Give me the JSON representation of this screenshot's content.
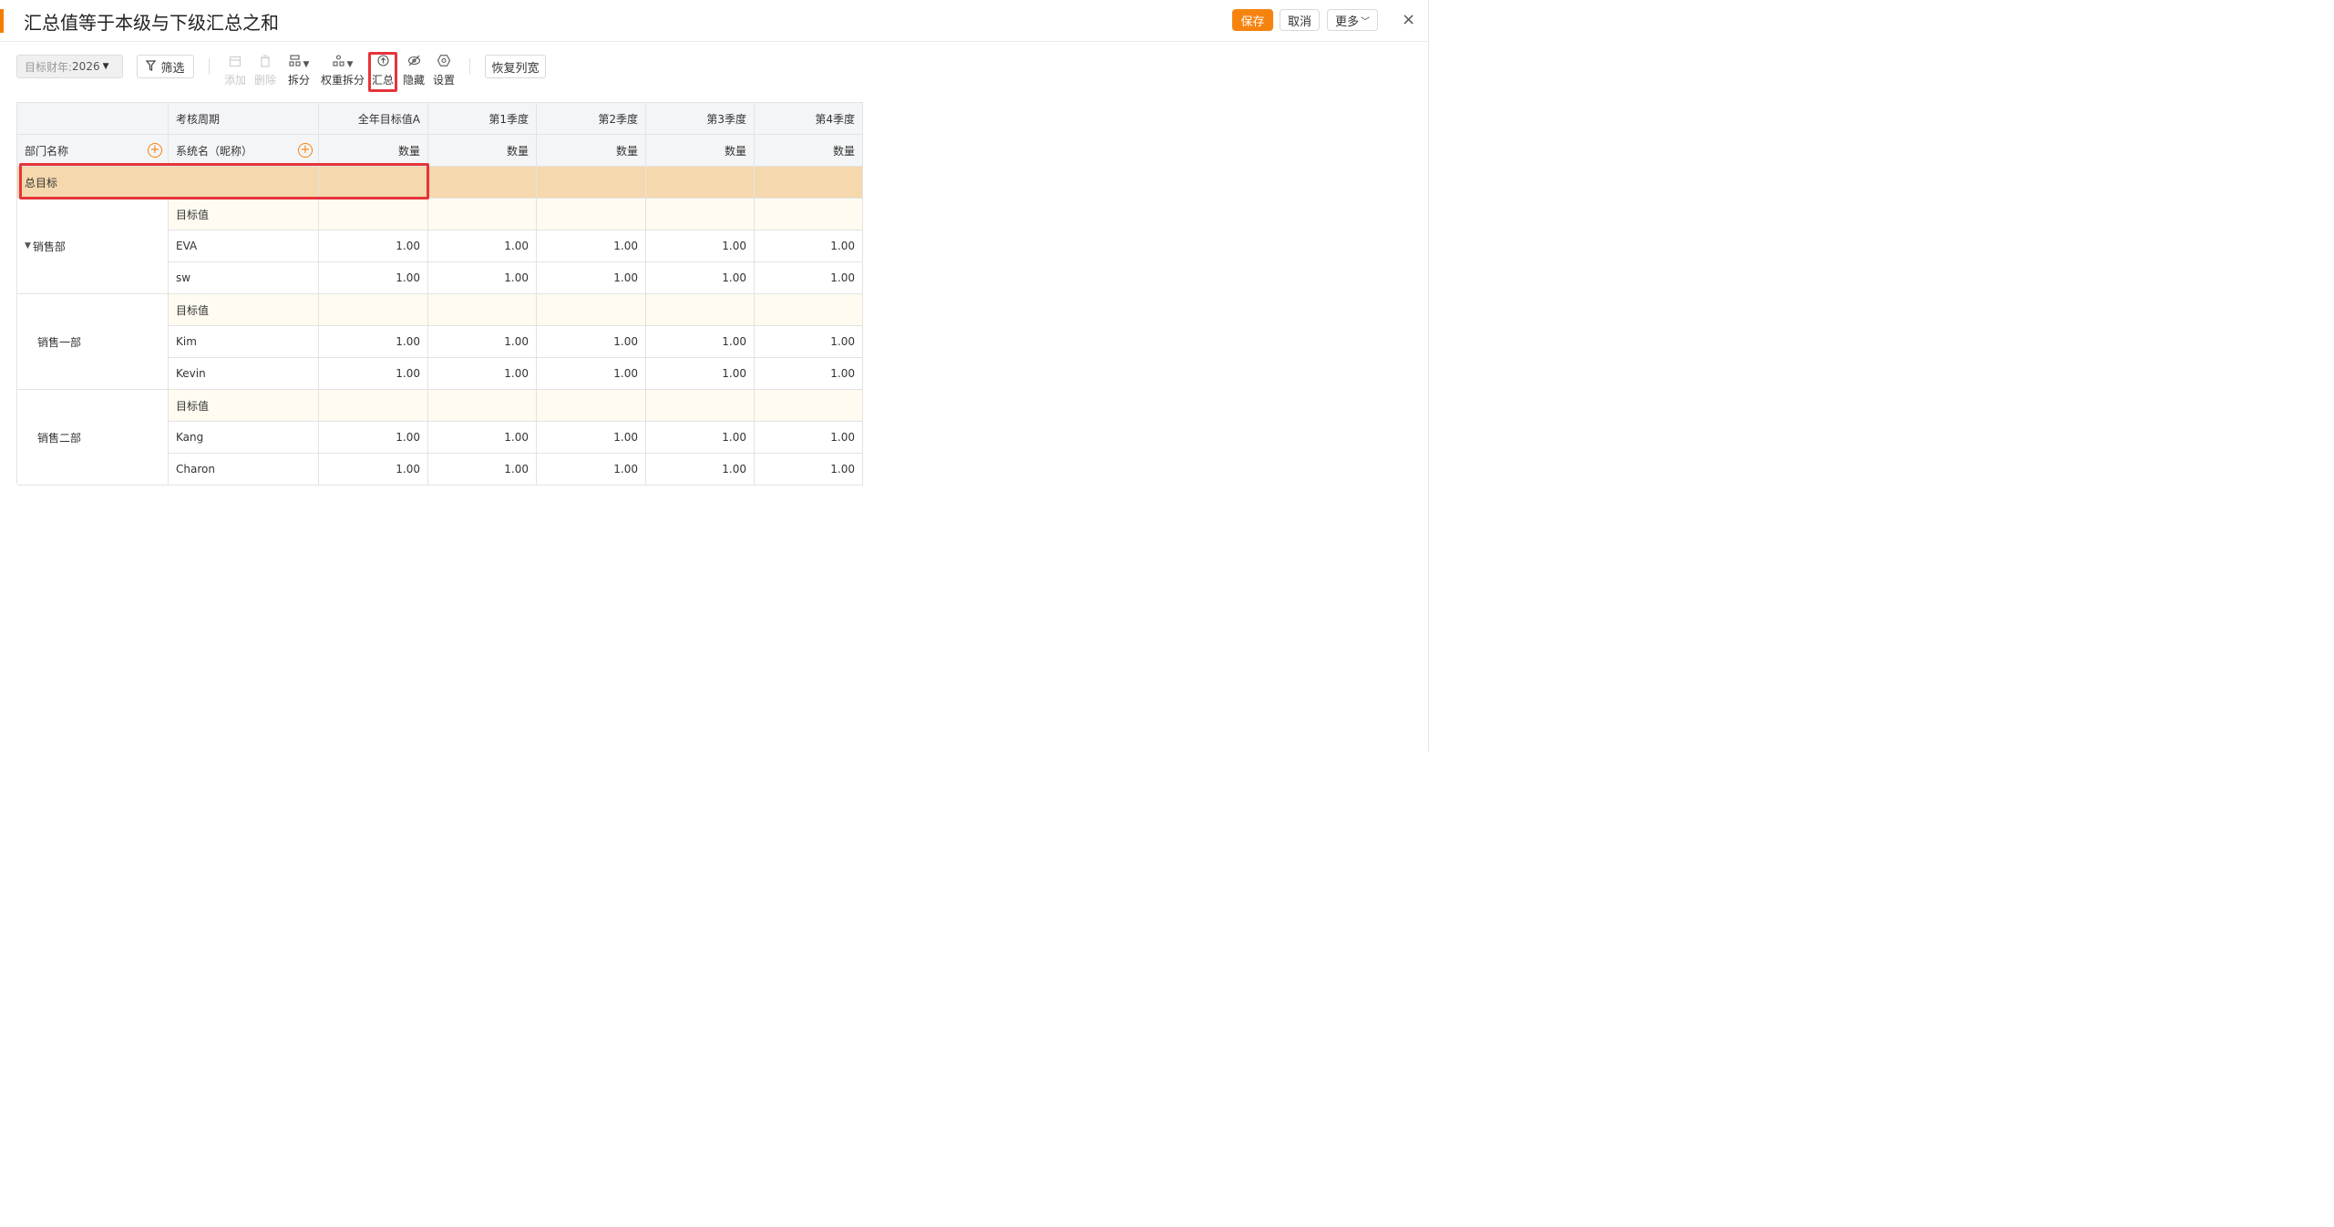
{
  "header": {
    "title": "汇总值等于本级与下级汇总之和",
    "save_label": "保存",
    "cancel_label": "取消",
    "more_label": "更多",
    "close_label": "×"
  },
  "toolbar": {
    "year_label": "目标财年:",
    "year_value": "2026",
    "filter_label": "筛选",
    "add_label": "添加",
    "delete_label": "删除",
    "split_label": "拆分",
    "weight_split_label": "权重拆分",
    "summary_label": "汇总",
    "hide_label": "隐藏",
    "settings_label": "设置",
    "restore_width_label": "恢复列宽"
  },
  "table": {
    "period_header": "考核周期",
    "dept_header": "部门名称",
    "system_header": "系统名（昵称）",
    "period_columns": [
      "全年目标值A",
      "第1季度",
      "第2季度",
      "第3季度",
      "第4季度"
    ],
    "measure_label": "数量",
    "total_label": "总目标",
    "target_label": "目标值",
    "groups": [
      {
        "dept": "销售部",
        "members": [
          {
            "name": "EVA",
            "values": [
              "1.00",
              "1.00",
              "1.00",
              "1.00",
              "1.00"
            ]
          },
          {
            "name": "sw",
            "values": [
              "1.00",
              "1.00",
              "1.00",
              "1.00",
              "1.00"
            ]
          }
        ]
      },
      {
        "dept": "销售一部",
        "members": [
          {
            "name": "Kim",
            "values": [
              "1.00",
              "1.00",
              "1.00",
              "1.00",
              "1.00"
            ]
          },
          {
            "name": "Kevin",
            "values": [
              "1.00",
              "1.00",
              "1.00",
              "1.00",
              "1.00"
            ]
          }
        ]
      },
      {
        "dept": "销售二部",
        "members": [
          {
            "name": "Kang",
            "values": [
              "1.00",
              "1.00",
              "1.00",
              "1.00",
              "1.00"
            ]
          },
          {
            "name": "Charon",
            "values": [
              "1.00",
              "1.00",
              "1.00",
              "1.00",
              "1.00"
            ]
          }
        ]
      }
    ]
  }
}
